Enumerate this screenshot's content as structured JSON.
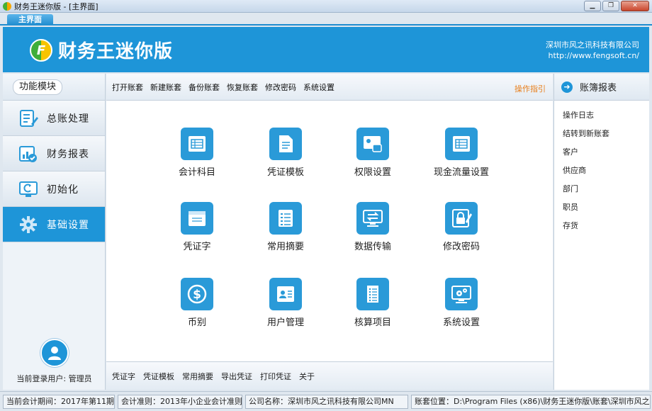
{
  "window": {
    "title": "财务王迷你版 - [主界面]"
  },
  "tab": {
    "label": "主界面"
  },
  "banner": {
    "app_name": "财务王迷你版",
    "logo_letter": "F",
    "company_name": "深圳市风之讯科技有限公司",
    "company_url": "http://www.fengsoft.cn/"
  },
  "left": {
    "header": "功能模块",
    "items": [
      {
        "label": "总账处理",
        "icon": "ledger-edit-icon"
      },
      {
        "label": "财务报表",
        "icon": "report-chart-icon"
      },
      {
        "label": "初始化",
        "icon": "initialize-monitor-icon"
      },
      {
        "label": "基础设置",
        "icon": "gear-icon"
      }
    ],
    "active_index": 3,
    "user_label": "当前登录用户: 管理员"
  },
  "toolbar": {
    "items": [
      "打开账套",
      "新建账套",
      "备份账套",
      "恢复账套",
      "修改密码",
      "系统设置"
    ],
    "guide": "操作指引"
  },
  "tiles": [
    {
      "label": "会计科目",
      "icon": "table-sheet-icon"
    },
    {
      "label": "凭证模板",
      "icon": "document-icon"
    },
    {
      "label": "权限设置",
      "icon": "permission-lock-icon"
    },
    {
      "label": "现金流量设置",
      "icon": "table-sheet-icon"
    },
    {
      "label": "凭证字",
      "icon": "voucher-sheet-icon"
    },
    {
      "label": "常用摘要",
      "icon": "list-icon"
    },
    {
      "label": "数据传输",
      "icon": "data-transfer-icon"
    },
    {
      "label": "修改密码",
      "icon": "password-edit-icon"
    },
    {
      "label": "币别",
      "icon": "currency-dollar-icon"
    },
    {
      "label": "用户管理",
      "icon": "user-card-icon"
    },
    {
      "label": "核算项目",
      "icon": "checklist-icon"
    },
    {
      "label": "系统设置",
      "icon": "system-settings-icon"
    }
  ],
  "bottombar": {
    "items": [
      "凭证字",
      "凭证模板",
      "常用摘要",
      "导出凭证",
      "打印凭证",
      "关于"
    ]
  },
  "right": {
    "header": "账簿报表",
    "items": [
      "操作日志",
      "结转到新账套",
      "客户",
      "供应商",
      "部门",
      "职员",
      "存货"
    ]
  },
  "status": {
    "period": "当前会计期间：2017年第11期",
    "standard": "会计准则：2013年小企业会计准则",
    "company": "公司名称：深圳市风之讯科技有限公司MN",
    "location": "账套位置：D:\\Program Files (x86)\\财务王迷你版\\账套\\深圳市风之"
  },
  "colors": {
    "accent": "#1e95d8",
    "guide": "#e87e1a"
  }
}
